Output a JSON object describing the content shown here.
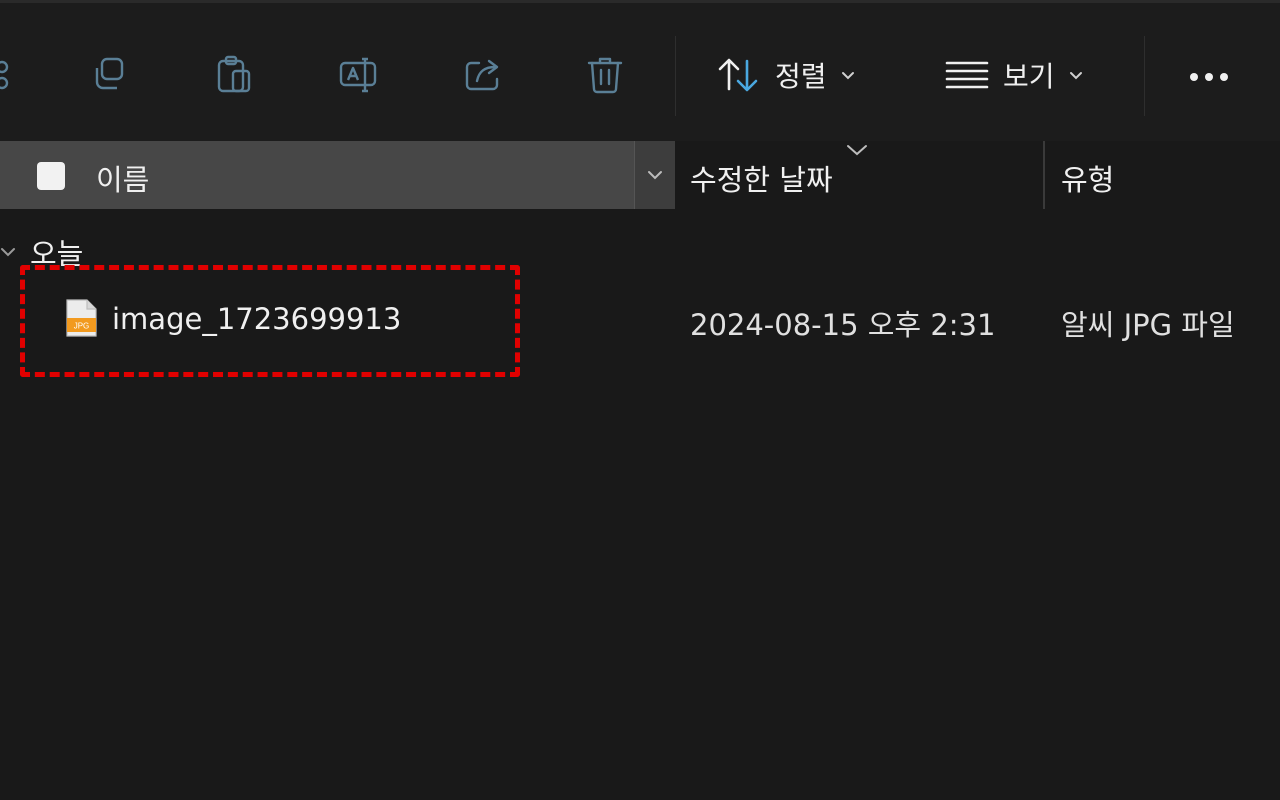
{
  "toolbar": {
    "icons": [
      "share-arrow-icon-partial",
      "copy-icon",
      "paste-icon",
      "rename-icon",
      "share-icon",
      "delete-icon"
    ],
    "sort_label": "정렬",
    "view_label": "보기",
    "more_icon": "more-icon"
  },
  "columns": {
    "name": "이름",
    "date_modified": "수정한 날짜",
    "type": "유형"
  },
  "groups": [
    {
      "label": "오늘",
      "files": [
        {
          "name": "image_1723699913",
          "date": "2024-08-15 오후 2:31",
          "type": "알씨 JPG 파일",
          "icon": "jpg-file-icon"
        }
      ]
    }
  ],
  "colors": {
    "background": "#191919",
    "header_selected": "#474747",
    "accent_blue": "#4aa8e0",
    "highlight_red": "#e00000",
    "file_icon_orange": "#f29a1f"
  }
}
